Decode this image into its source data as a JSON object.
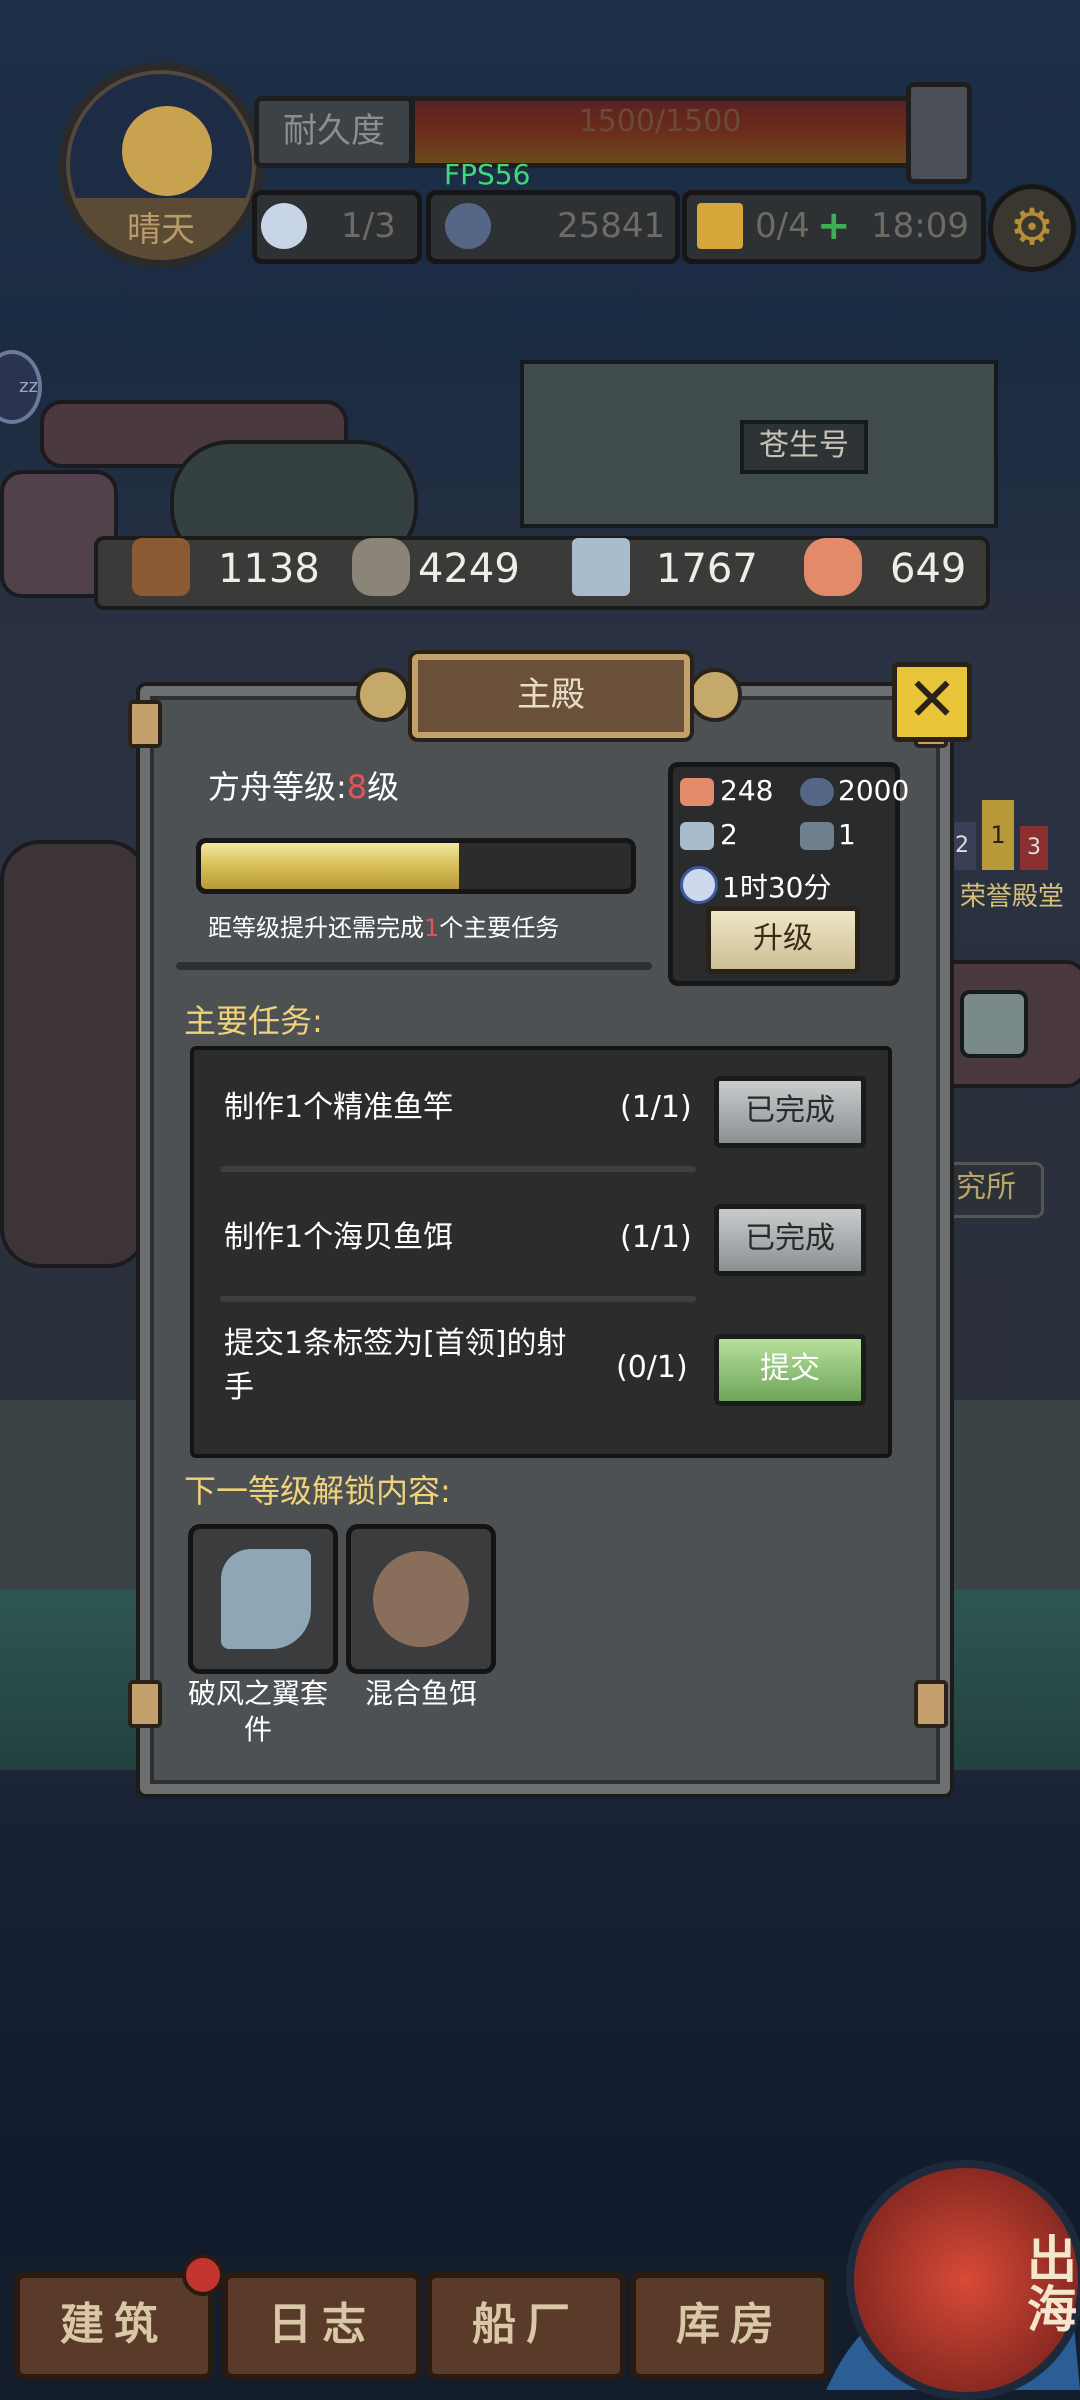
{
  "hud": {
    "weather": "晴天",
    "durability_label": "耐久度",
    "durability_value": "1500/1500",
    "fps": "FPS56",
    "crew": "1/3",
    "currency": "25841",
    "energy": "0/4",
    "timer": "18:09",
    "zz": "zz"
  },
  "scene": {
    "ship_name": "苍生号",
    "honor_hall": "荣誉殿堂",
    "honor_ranks": [
      "2",
      "1",
      "3"
    ],
    "research": "究所"
  },
  "resources": [
    {
      "icon": "wood-log-icon",
      "value": "1138"
    },
    {
      "icon": "stone-icon",
      "value": "4249"
    },
    {
      "icon": "iron-ingot-icon",
      "value": "1767"
    },
    {
      "icon": "fish-meat-icon",
      "value": "649"
    }
  ],
  "modal": {
    "title": "主殿",
    "ark_level_prefix": "方舟等级:",
    "ark_level_value": "8",
    "ark_level_suffix": "级",
    "progress": 0.6,
    "hint_prefix": "距等级提升还需完成",
    "hint_count": "1",
    "hint_suffix": "个主要任务",
    "cost": {
      "fish": "248",
      "gear": "2000",
      "iron": "2",
      "barrel": "1",
      "time": "1时30分"
    },
    "upgrade_label": "升级",
    "main_tasks_title": "主要任务:",
    "tasks": [
      {
        "text": "制作1个精准鱼竿",
        "count": "(1/1)",
        "button": "已完成"
      },
      {
        "text": "制作1个海贝鱼饵",
        "count": "(1/1)",
        "button": "已完成"
      },
      {
        "text": "提交1条标签为[首领]的射手",
        "count": "(0/1)",
        "button": "提交"
      }
    ],
    "unlock_title": "下一等级解锁内容:",
    "unlocks": [
      {
        "label": "破风之翼套件",
        "icon": "wing-kit-icon"
      },
      {
        "label": "混合鱼饵",
        "icon": "mixed-bait-icon"
      }
    ]
  },
  "nav": {
    "build": "建筑",
    "log": "日志",
    "shipyard": "船厂",
    "warehouse": "库房",
    "sea": "出海"
  },
  "colors": {
    "accent_gold": "#f0d27a",
    "level_red": "#e0555a",
    "fps_green": "#41d879"
  }
}
